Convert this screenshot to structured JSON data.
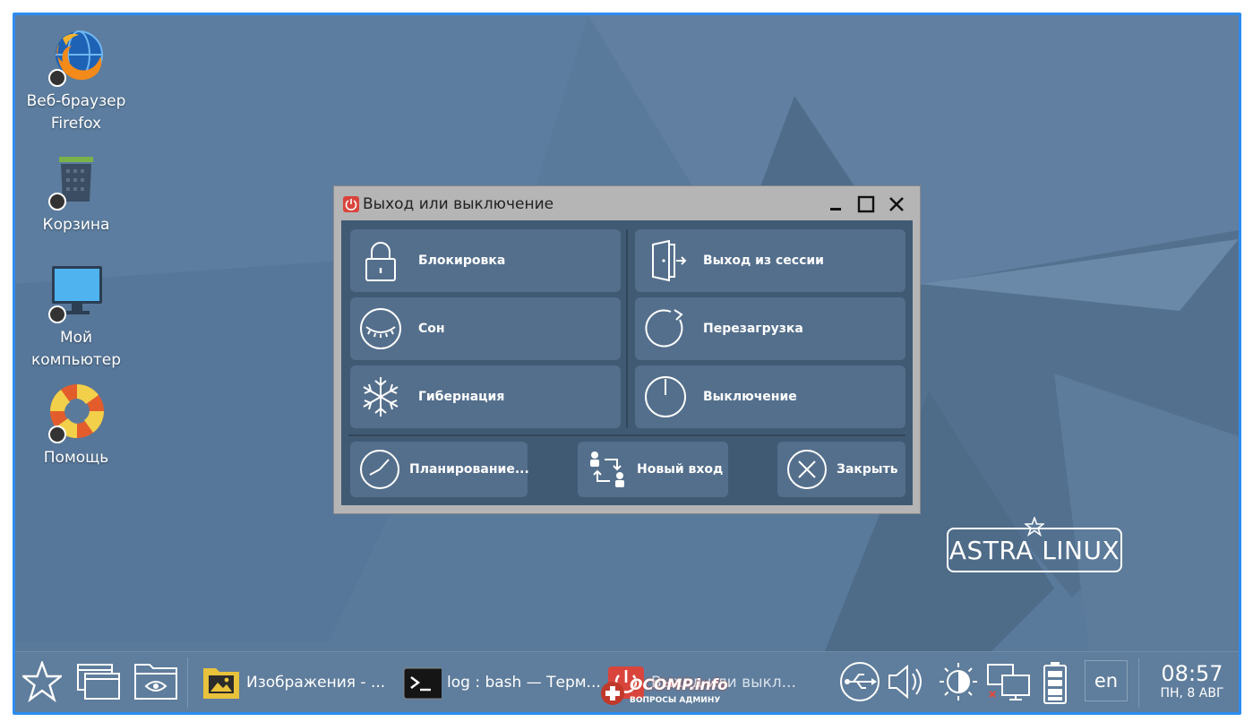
{
  "desktop": {
    "icons": [
      {
        "label_line1": "Веб-браузер",
        "label_line2": "Firefox",
        "icon": "firefox-icon"
      },
      {
        "label_line1": "Корзина",
        "label_line2": "",
        "icon": "trash-icon"
      },
      {
        "label_line1": "Мой",
        "label_line2": "компьютер",
        "icon": "computer-icon"
      },
      {
        "label_line1": "Помощь",
        "label_line2": "",
        "icon": "lifebuoy-icon"
      }
    ]
  },
  "dialog": {
    "title": "Выход или выключение",
    "options": {
      "lock": "Блокировка",
      "logout": "Выход из сессии",
      "sleep": "Сон",
      "reboot": "Перезагрузка",
      "hibernate": "Гибернация",
      "shutdown": "Выключение",
      "schedule": "Планирование...",
      "new_login": "Новый вход",
      "close": "Закрыть"
    }
  },
  "logo": {
    "text": "ASTRA LINUX"
  },
  "taskbar": {
    "tasks": [
      {
        "label": "Изображения - ...",
        "icon": "images-folder-icon"
      },
      {
        "label": "log : bash — Терм...",
        "icon": "terminal-icon"
      },
      {
        "label": "Выход или выкл...",
        "icon": "power-icon"
      }
    ],
    "language": "en",
    "clock": {
      "time": "08:57",
      "date": "ПН, 8 АВГ"
    }
  },
  "watermark": {
    "text": "OCOMP.info",
    "sub": "ВОПРОСЫ АДМИНУ"
  },
  "colors": {
    "desktop_bg": "#5a7a9c",
    "dialog_body": "#415a74",
    "option_bg": "#546f8c",
    "frame": "#2d8cf0"
  }
}
